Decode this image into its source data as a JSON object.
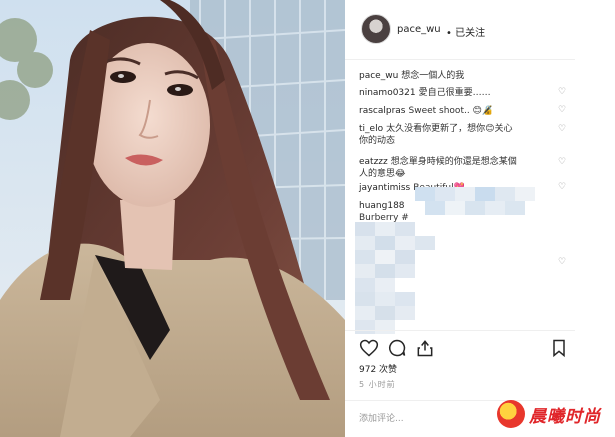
{
  "post": {
    "username": "pace_wu",
    "follow_status": "• 已关注"
  },
  "comments": [
    {
      "user": "pace_wu",
      "text": "想念一個人的我"
    },
    {
      "user": "ninamo0321",
      "text": "愛自己很重要……"
    },
    {
      "user": "rascalpras",
      "text": "Sweet shoot.. 😊🔏"
    },
    {
      "user": "ti_elo",
      "text": "太久没看你更新了，想你😊关心"
    },
    {
      "user": "",
      "text": "你的动态"
    },
    {
      "user": "eatzzz",
      "text": "想念單身時候的你還是想念某個"
    },
    {
      "user": "",
      "text": "人的意思😂"
    },
    {
      "user": "jayantimiss",
      "text": "Beautiful💖"
    },
    {
      "user": "huang188",
      "text": ""
    },
    {
      "user": "",
      "text": "Burberry #"
    },
    {
      "user": "",
      "text": "berry"
    }
  ],
  "likes": "972 次赞",
  "time": "5 小时前",
  "add_comment_placeholder": "添加评论...",
  "watermark": "晨曦时尚",
  "icons": {
    "like": "heart-icon",
    "comment": "comment-icon",
    "share": "share-icon",
    "save": "bookmark-icon"
  },
  "colors": {
    "text": "#262626",
    "muted": "#999999",
    "border": "#efefef",
    "watermark_red": "#e0262a"
  }
}
